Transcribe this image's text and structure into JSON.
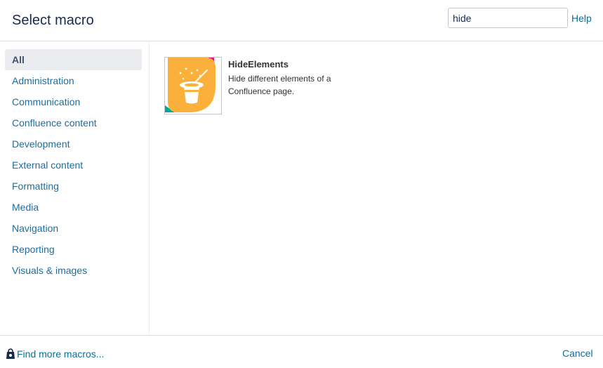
{
  "header": {
    "title": "Select macro",
    "search_value": "hide",
    "help_label": "Help"
  },
  "sidebar": {
    "items": [
      {
        "label": "All",
        "active": true
      },
      {
        "label": "Administration"
      },
      {
        "label": "Communication"
      },
      {
        "label": "Confluence content"
      },
      {
        "label": "Development"
      },
      {
        "label": "External content"
      },
      {
        "label": "Formatting"
      },
      {
        "label": "Media"
      },
      {
        "label": "Navigation"
      },
      {
        "label": "Reporting"
      },
      {
        "label": "Visuals & images"
      }
    ]
  },
  "results": [
    {
      "name": "HideElements",
      "description": "Hide different elements of a Confluence page.",
      "icon": "magic-hat-icon"
    }
  ],
  "footer": {
    "find_more_label": "Find more macros...",
    "find_more_icon": "shopping-bag-icon",
    "cancel_label": "Cancel"
  },
  "colors": {
    "link": "#0b6e99",
    "active_bg": "#ebecf0",
    "icon_orange": "#fbb03b",
    "icon_pink": "#e9186e",
    "icon_teal": "#00a99d"
  }
}
